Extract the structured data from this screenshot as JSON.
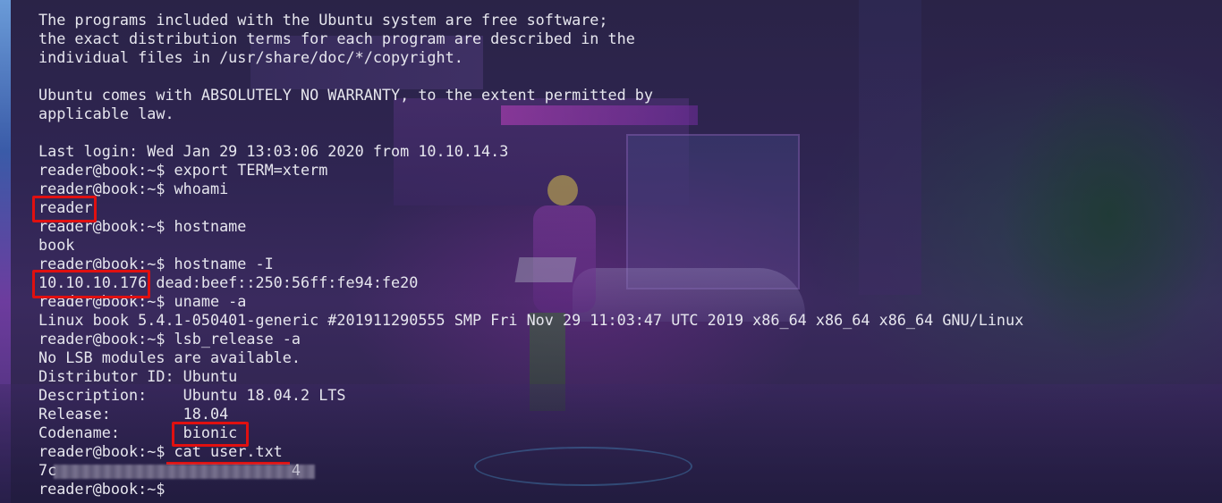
{
  "terminal": {
    "lines": [
      "The programs included with the Ubuntu system are free software;",
      "the exact distribution terms for each program are described in the",
      "individual files in /usr/share/doc/*/copyright.",
      "",
      "Ubuntu comes with ABSOLUTELY NO WARRANTY, to the extent permitted by",
      "applicable law.",
      "",
      "Last login: Wed Jan 29 13:03:06 2020 from 10.10.14.3",
      "reader@book:~$ export TERM=xterm",
      "reader@book:~$ whoami",
      "reader",
      "reader@book:~$ hostname",
      "book",
      "reader@book:~$ hostname -I",
      "10.10.10.176 dead:beef::250:56ff:fe94:fe20",
      "reader@book:~$ uname -a",
      "Linux book 5.4.1-050401-generic #201911290555 SMP Fri Nov 29 11:03:47 UTC 2019 x86_64 x86_64 x86_64 GNU/Linux",
      "reader@book:~$ lsb_release -a",
      "No LSB modules are available.",
      "Distributor ID: Ubuntu",
      "Description:    Ubuntu 18.04.2 LTS",
      "Release:        18.04",
      "Codename:       bionic",
      "reader@book:~$ cat user.txt",
      "7c                          4",
      "reader@book:~$ "
    ]
  },
  "colors": {
    "terminal_text": "#e6e6ee",
    "highlight": "#e01010",
    "background": "#2f2552"
  }
}
